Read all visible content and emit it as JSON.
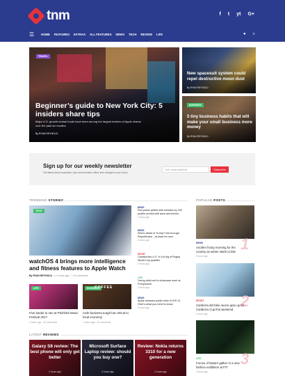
{
  "header": {
    "logo_text": "tnm",
    "socials": [
      "f",
      "t",
      "yt",
      "G+"
    ]
  },
  "nav": {
    "items": [
      "HOME",
      "FEATURES",
      "EXTRAS",
      "ALL FEATURES",
      "NEWS",
      "TECH",
      "REVIEW",
      "LIFE"
    ]
  },
  "hero": {
    "main": {
      "tag": "TRAVEL",
      "title": "Beginner’s guide to New York City: 5 insiders share tips",
      "excerpt": "Major U.S. growth mutual funds have been among the largest holders of Apple shares over the past six months.",
      "byline": "By RYAN REYNOLD"
    },
    "side": [
      {
        "tag": "",
        "title": "New spacesuit system could repel destructive moon dust",
        "byline": "By RYAN REYNOLD"
      },
      {
        "tag": "BUSINESS",
        "title": "5 tiny business habits that will make your small business more money",
        "byline": "By RYAN REYNOLD"
      }
    ]
  },
  "newsletter": {
    "title": "Sign up for our weekly newsletter",
    "subtitle": "Get latest travel inspiration, tips and exclusive offers sent straight to your inbox",
    "placeholder": "Your email address",
    "button": "Subscribe"
  },
  "trending": {
    "label_prefix": "TRENDING",
    "label_bold": "STORIES",
    "main": {
      "tag": "TECH",
      "title": "watchOS 4 brings more intelligence and fitness features to Apple Watch",
      "author": "By RYAN REYNOLD",
      "date": "2 hours ago",
      "comments": "20 comments"
    },
    "small": [
      {
        "tag": "LIFE",
        "title": "Five bands to see at Pitchfork Music Festival 2017",
        "meta": "2 hours ago  ·  20 comments"
      },
      {
        "tag": "BUSINESS",
        "overlay": "COFFEE",
        "title": "Cafe business tough but critical to local economy",
        "meta": "2 hours ago  ·  20 comments"
      }
    ],
    "list": [
      {
        "cat": "NEWS",
        "color": "#2b3b8e",
        "title": "Riot police pelted with missiles by 200 youths armed with axes and knives",
        "meta": "2 hours ago"
      },
      {
        "cat": "NEWS",
        "color": "#2b3b8e",
        "title": "Who's afraid of Trump? Not enough Republicans – at least for now",
        "meta": "2 hours ago"
      },
      {
        "cat": "SPORT",
        "color": "#e8323c",
        "title": "Canada ties U.S. in 1st leg of Rugby World Cup qualifier",
        "meta": "2 hours ago"
      },
      {
        "cat": "LIFE",
        "color": "#3cbf6b",
        "title": "Young artist set to showcase work at Pumphouse",
        "meta": "2 hours ago"
      },
      {
        "cat": "NEWS",
        "color": "#2b3b8e",
        "title": "Apple releases public beta of iOS 11: Here's what you need to know",
        "meta": "2 hours ago"
      }
    ]
  },
  "popular": {
    "label_prefix": "POPULAR",
    "label_bold": "POSTS",
    "items": [
      {
        "num": "1",
        "cat": "NEWS",
        "title": "Another frosty morning for the country as winter starts to bite",
        "meta": "2 hours ago"
      },
      {
        "num": "2",
        "cat": "SPORT",
        "title": "Canberra dirt bike racers gear up for Canberra Cup this weekend",
        "meta": "2 hours ago"
      },
      {
        "num": "3",
        "cat": "LIFE",
        "title": "Forces of Nature gather in a new fashion exhibition at FIT",
        "meta": "2 hours ago"
      }
    ]
  },
  "reviews": {
    "label_prefix": "LATEST",
    "label_bold": "REVIEWS",
    "items": [
      {
        "title": "Galaxy S8 review: The best phone will only get better",
        "meta": "2 hours ago"
      },
      {
        "title": "Microsoft Surface Laptop review: should you buy one?",
        "meta": "2 hours ago"
      },
      {
        "title": "Review: Nokia returns 3310 for a new generation",
        "meta": "2 hours ago"
      }
    ]
  },
  "colors": {
    "brand": "#2b3b8e",
    "accent": "#e8323c"
  }
}
